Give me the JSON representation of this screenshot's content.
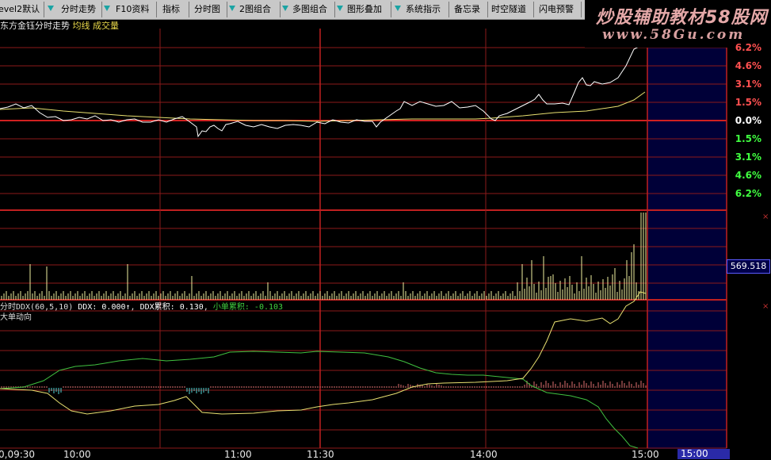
{
  "toolbar": {
    "items": [
      {
        "label": "evel2默认",
        "arrow": false
      },
      {
        "label": "分时走势",
        "arrow": true
      },
      {
        "label": "F10资料",
        "arrow": true
      },
      {
        "label": "指标",
        "arrow": false
      },
      {
        "label": "分时图",
        "arrow": true
      },
      {
        "label": "2图组合",
        "arrow": true
      },
      {
        "label": "多图组合",
        "arrow": true
      },
      {
        "label": "图形叠加",
        "arrow": false
      },
      {
        "label": "系统指示",
        "arrow": true
      },
      {
        "label": "备忘录",
        "arrow": false
      },
      {
        "label": "时空隧道",
        "arrow": false
      },
      {
        "label": "闪电预警",
        "arrow": false
      }
    ]
  },
  "brand": {
    "title": "炒股辅助教材58股网",
    "url": "www.58Gu.com"
  },
  "chart_header": {
    "name": "东方金钰分时走势",
    "avg_line": "均线",
    "volume": "成交量"
  },
  "price_scale": {
    "labels": [
      "6.2%",
      "4.6%",
      "3.1%",
      "1.5%",
      "0.0%",
      "1.5%",
      "3.1%",
      "4.6%",
      "6.2%"
    ],
    "colors": {
      "up": "#ff5050",
      "zero": "#ffffff",
      "down": "#40ff40"
    }
  },
  "volume_readout": "569.518",
  "ddx": {
    "title": "分时DDX(60,5,10)",
    "ddx_label": "DDX:",
    "ddx_value": "0.000↑",
    "ddx_cum_label": "DDX累积:",
    "ddx_cum_value": "0.130",
    "small_cum_label": "小单累积:",
    "small_cum_value": "-0.103",
    "sub_label": "大单动向"
  },
  "time_axis": {
    "labels": [
      "0,09:30",
      "10:00",
      "11:00",
      "11:30",
      "14:00",
      "15:00"
    ],
    "current_time": "15:00"
  },
  "colors": {
    "grid": "#8b1a1a",
    "price_line": "#ffffff",
    "avg_line": "#e8e070",
    "volume_bar": "#f0f0a0",
    "ddx_up": "#e07070",
    "ddx_down": "#50d8d8",
    "green_line": "#40c040",
    "future_fill": "#000038"
  }
}
